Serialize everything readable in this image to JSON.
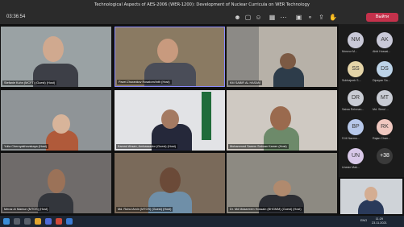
{
  "meeting": {
    "title": "Technological Aspects of AES-2006 (WER-1200): Development of Nuclear Curricula on WER Technology",
    "timer": "03:36:54",
    "leave_label": "Выйти"
  },
  "tiles": [
    {
      "name": "Stefanie Kuhn (MCFT) (Guest) (Host)"
    },
    {
      "name": "Pavel Zhurankov Rosatom/Inth (Host)"
    },
    {
      "name": "KM SABIR AL HASAN"
    },
    {
      "name": "Yulia Chernyakhovskaya (Host)"
    },
    {
      "name": "Kamrul Ahsan, Ambassador (Guest) (Host)"
    },
    {
      "name": "Mohammed Saeem Selman Kamer (Host)"
    },
    {
      "name": "Meraz Al Mamun (MTOS) (Host)"
    },
    {
      "name": "Md. Ruhul Amin (MTOS) (Guest) (Host)"
    },
    {
      "name": "Dr. Md Mokarrrem Hossain (BHGMM) (Guest) (Host)"
    }
  ],
  "roster": [
    {
      "initials": "NM",
      "name": "Monzur M...",
      "color": "#c9c9d8"
    },
    {
      "initials": "AK",
      "name": "Abid Hossai...",
      "color": "#c9c9d8"
    },
    {
      "initials": "SS",
      "name": "Subhajeeb S...",
      "color": "#e5d5a8"
    },
    {
      "initials": "DS",
      "name": "Dipayan Sa...",
      "color": "#bcd3e8"
    },
    {
      "initials": "DR",
      "name": "Saiwa Rehman...",
      "color": "#c9ccd4"
    },
    {
      "initials": "MT",
      "name": "Md. Simul ...",
      "color": "#c9ccd4"
    },
    {
      "initials": "BP",
      "name": "S M Nazmu...",
      "color": "#b7c8ea"
    },
    {
      "initials": "RK",
      "name": "Rajan Chan...",
      "color": "#f0c8c0"
    },
    {
      "initials": "UN",
      "name": "Unesin Mah...",
      "color": "#d8c8e8"
    },
    {
      "initials": "+38",
      "name": "",
      "color": "#3a3a3a"
    }
  ],
  "taskbar": {
    "time": "11:29",
    "date": "23.11.2021",
    "lang": "ENG"
  }
}
